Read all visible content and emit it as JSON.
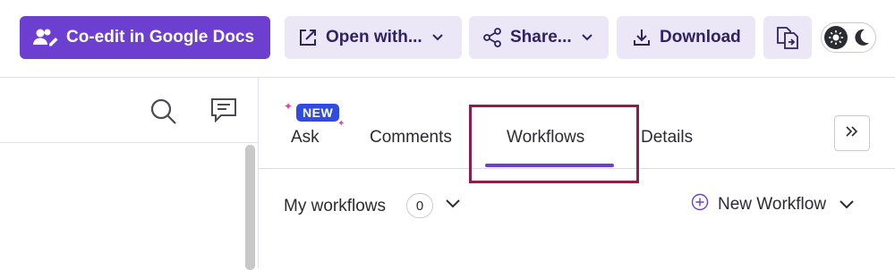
{
  "toolbar": {
    "coedit_label": "Co-edit in Google Docs",
    "open_label": "Open with...",
    "share_label": "Share...",
    "download_label": "Download"
  },
  "panel": {
    "tabs": [
      {
        "label": "Ask",
        "badge": "NEW"
      },
      {
        "label": "Comments"
      },
      {
        "label": "Workflows",
        "active": true
      },
      {
        "label": "Details"
      }
    ]
  },
  "workflows": {
    "title": "My workflows",
    "count": "0",
    "new_label": "New Workflow"
  },
  "colors": {
    "accent": "#6c3fd1",
    "light_button": "#ece7f7",
    "new_badge": "#2f4be0",
    "highlight": "#8a1f4a"
  },
  "icons": [
    "users-edit-icon",
    "open-external-icon",
    "share-icon",
    "download-icon",
    "convert-icon",
    "sun-icon",
    "moon-icon",
    "search-icon",
    "comment-icon",
    "double-chevron-right-icon",
    "plus-circle-icon",
    "chevron-down-icon"
  ]
}
